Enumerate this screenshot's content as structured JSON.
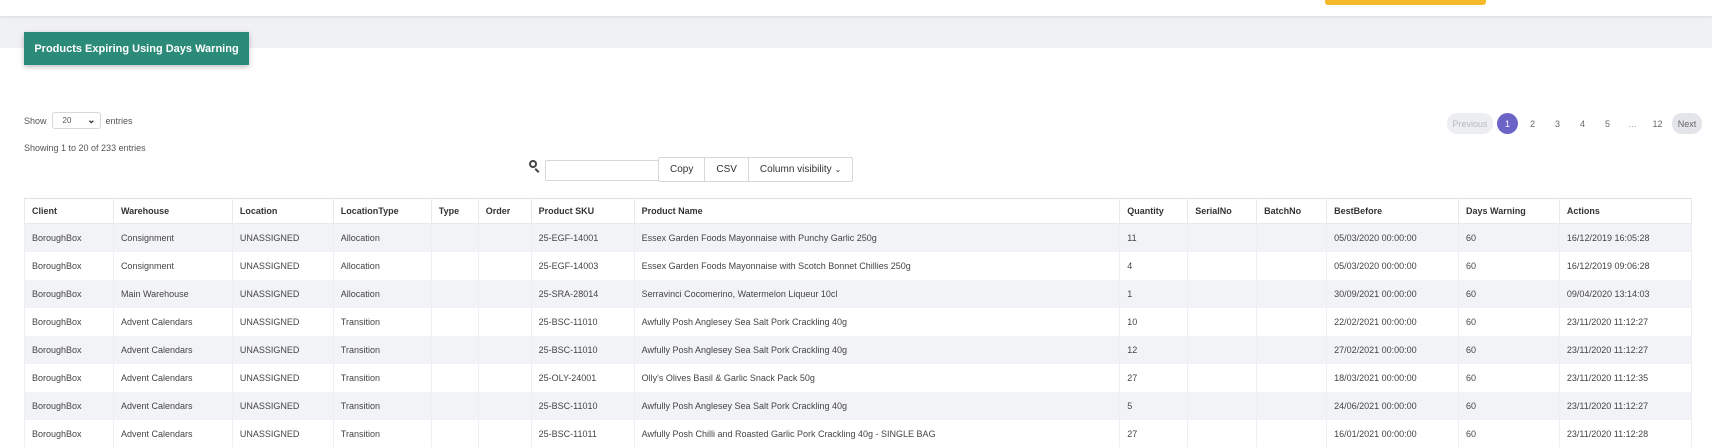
{
  "page": {
    "title": "Products Expiring Using Days Warning"
  },
  "colors": {
    "title_bg": "#2b8a78",
    "pager_active": "#6c63c7",
    "topbar_accent": "#f6b92b"
  },
  "controls": {
    "show_label": "Show",
    "length_value": "20",
    "entries_label": "entries",
    "info": "Showing 1 to 20 of 233 entries",
    "copy": "Copy",
    "csv": "CSV",
    "colvis": "Column visibility",
    "colvis_icon": "chevron-down-icon",
    "search_icon": "search-icon"
  },
  "pagination": {
    "previous": "Previous",
    "pages": [
      "1",
      "2",
      "3",
      "4",
      "5"
    ],
    "ellipsis": "…",
    "last": "12",
    "next": "Next",
    "current": "1"
  },
  "table": {
    "columns": [
      "Client",
      "Warehouse",
      "Location",
      "LocationType",
      "Type",
      "Order",
      "Product SKU",
      "Product Name",
      "Quantity",
      "SerialNo",
      "BatchNo",
      "BestBefore",
      "Days Warning",
      "Actions"
    ],
    "rows": [
      [
        "BoroughBox",
        "Consignment",
        "UNASSIGNED",
        "Allocation",
        "",
        "",
        "25-EGF-14001",
        "Essex Garden Foods Mayonnaise with Punchy Garlic 250g",
        "11",
        "",
        "",
        "05/03/2020 00:00:00",
        "60",
        "16/12/2019 16:05:28"
      ],
      [
        "BoroughBox",
        "Consignment",
        "UNASSIGNED",
        "Allocation",
        "",
        "",
        "25-EGF-14003",
        "Essex Garden Foods Mayonnaise with Scotch Bonnet Chillies 250g",
        "4",
        "",
        "",
        "05/03/2020 00:00:00",
        "60",
        "16/12/2019 09:06:28"
      ],
      [
        "BoroughBox",
        "Main Warehouse",
        "UNASSIGNED",
        "Allocation",
        "",
        "",
        "25-SRA-28014",
        "Serravinci Cocomerino, Watermelon Liqueur 10cl",
        "1",
        "",
        "",
        "30/09/2021 00:00:00",
        "60",
        "09/04/2020 13:14:03"
      ],
      [
        "BoroughBox",
        "Advent Calendars",
        "UNASSIGNED",
        "Transition",
        "",
        "",
        "25-BSC-11010",
        "Awfully Posh Anglesey Sea Salt Pork Crackling 40g",
        "10",
        "",
        "",
        "22/02/2021 00:00:00",
        "60",
        "23/11/2020 11:12:27"
      ],
      [
        "BoroughBox",
        "Advent Calendars",
        "UNASSIGNED",
        "Transition",
        "",
        "",
        "25-BSC-11010",
        "Awfully Posh Anglesey Sea Salt Pork Crackling 40g",
        "12",
        "",
        "",
        "27/02/2021 00:00:00",
        "60",
        "23/11/2020 11:12:27"
      ],
      [
        "BoroughBox",
        "Advent Calendars",
        "UNASSIGNED",
        "Transition",
        "",
        "",
        "25-OLY-24001",
        "Olly's Olives Basil & Garlic Snack Pack 50g",
        "27",
        "",
        "",
        "18/03/2021 00:00:00",
        "60",
        "23/11/2020 11:12:35"
      ],
      [
        "BoroughBox",
        "Advent Calendars",
        "UNASSIGNED",
        "Transition",
        "",
        "",
        "25-BSC-11010",
        "Awfully Posh Anglesey Sea Salt Pork Crackling 40g",
        "5",
        "",
        "",
        "24/06/2021 00:00:00",
        "60",
        "23/11/2020 11:12:27"
      ],
      [
        "BoroughBox",
        "Advent Calendars",
        "UNASSIGNED",
        "Transition",
        "",
        "",
        "25-BSC-11011",
        "Awfully Posh Chilli and Roasted Garlic Pork Crackling 40g - SINGLE BAG",
        "27",
        "",
        "",
        "16/01/2021 00:00:00",
        "60",
        "23/11/2020 11:12:28"
      ]
    ]
  }
}
